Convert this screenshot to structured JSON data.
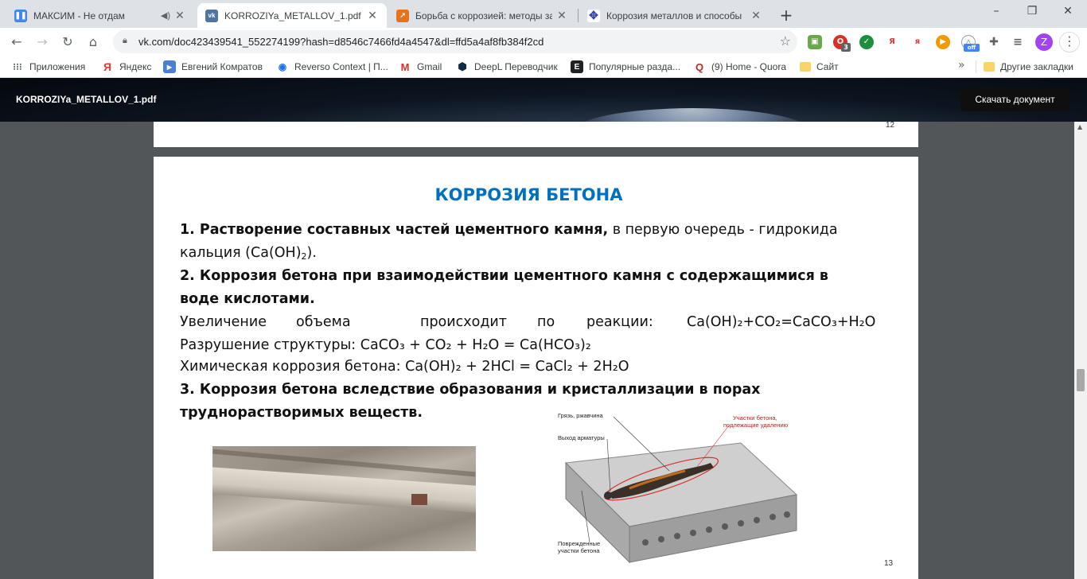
{
  "tabs": [
    {
      "title": "МАКСИМ - Не отдам",
      "icon": "pause-icon",
      "color": "#4285f4",
      "active": false
    },
    {
      "title": "KORROZIYa_METALLOV_1.pdf",
      "icon": "vk-icon",
      "color": "#4c75a3",
      "active": true
    },
    {
      "title": "Борьба с коррозией: методы за",
      "icon": "arrow-icon",
      "color": "#e8711a",
      "active": false
    },
    {
      "title": "Коррозия металлов и способы",
      "icon": "compass-icon",
      "color": "#3949ab",
      "active": false
    }
  ],
  "new_tab_label": "+",
  "window_controls": {
    "minimize": "–",
    "restore": "❐",
    "close": "✕"
  },
  "toolbar": {
    "url": "vk.com/doc423439541_552274199?hash=d8546c7466fd4a4547&dl=ffd5a4af8fb384f2cd",
    "profile_letter": "Z",
    "ext_badge": "3",
    "ext_off": "off"
  },
  "bookmarks": [
    {
      "label": "Приложения",
      "icon": "apps-icon"
    },
    {
      "label": "Яндекс",
      "icon": "yandex-icon"
    },
    {
      "label": "Евгений Комратов",
      "icon": "play-icon"
    },
    {
      "label": "Reverso Context | П...",
      "icon": "reverso-icon"
    },
    {
      "label": "Gmail",
      "icon": "gmail-icon"
    },
    {
      "label": "DeepL Переводчик",
      "icon": "deepl-icon"
    },
    {
      "label": "Популярные разда...",
      "icon": "e-icon"
    },
    {
      "label": "(9) Home - Quora",
      "icon": "quora-icon"
    },
    {
      "label": "Сайт",
      "icon": "folder-icon"
    },
    {
      "label": "Другие закладки",
      "icon": "folder-icon"
    }
  ],
  "bookmarks_more": "»",
  "doc": {
    "filename": "KORROZIYa_METALLOV_1.pdf",
    "download_label": "Скачать документ"
  },
  "pages": {
    "prev_number": "12",
    "current_number": "13"
  },
  "slide": {
    "title": "КОРРОЗИЯ БЕТОНА",
    "item1_bold": "1. Растворение составных частей цементного камня,",
    "item1_rest": " в первую очередь - гидрокида",
    "item1_line2": "кальция (Ca(OH)",
    "item1_line2_sub": "2",
    "item1_line2_end": ").",
    "item2_line1": "2. Коррозия бетона при взаимодействии цементного камня с содержащимися в",
    "item2_line2": "воде кислотами.",
    "volume_words": [
      "Увеличение",
      "объема",
      "происходит",
      "по",
      "реакции:"
    ],
    "volume_formula": "Ca(OH)₂+CO₂=CaCO₃+H₂O",
    "destruction": "Разрушение структуры: CaCO₃ + CO₂ + H₂O = Ca(HCO₃)₂",
    "chemical": "Химическая коррозия бетона: Ca(OH)₂ + 2HCl = CaCl₂ + 2H₂O",
    "item3_line1": "3. Коррозия бетона вследствие образования и кристаллизации в порах",
    "item3_line2": "труднорастворимых веществ."
  },
  "diagram": {
    "label_dirt": "Грязь, ржавчина",
    "label_rebar": "Выход арматуры",
    "label_remove_1": "Участки бетона,",
    "label_remove_2": "подлежащие удалению",
    "label_damaged_1": "Поврежденные",
    "label_damaged_2": "участки бетона"
  }
}
